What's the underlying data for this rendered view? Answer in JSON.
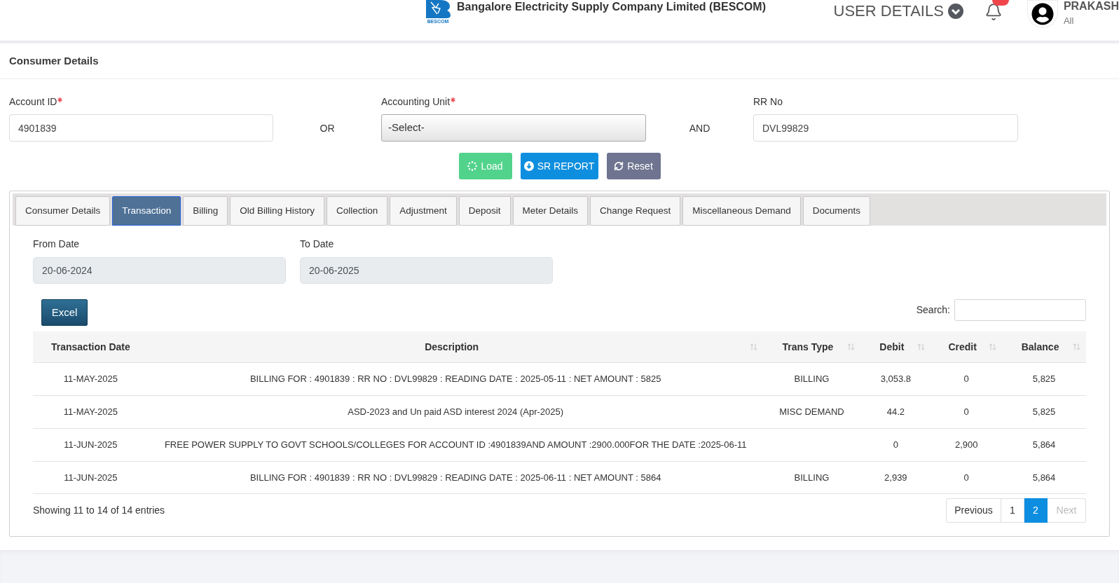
{
  "header": {
    "logo_text": "BESCOM",
    "title": "Bangalore Electricity Supply Company Limited (BESCOM)",
    "user_menu": "USER DETAILS",
    "notification_badge": true,
    "user": {
      "name": "PRAKASH",
      "role": "All"
    }
  },
  "section_title": "Consumer Details",
  "form": {
    "fields": [
      {
        "kind": "input",
        "label": "Account ID",
        "required": true,
        "value": "4901839"
      },
      {
        "kind": "connector",
        "text": "OR"
      },
      {
        "kind": "select",
        "label": "Accounting Unit",
        "required": true,
        "value": "-Select-"
      },
      {
        "kind": "connector",
        "text": "AND"
      },
      {
        "kind": "input",
        "label": "RR No",
        "required": false,
        "value": "DVL99829"
      }
    ]
  },
  "buttons": [
    {
      "kind": "load",
      "label": "Load"
    },
    {
      "kind": "report",
      "label": "SR REPORT"
    },
    {
      "kind": "reset",
      "label": "Reset"
    }
  ],
  "tabs": [
    {
      "label": "Consumer Details",
      "selected": false
    },
    {
      "label": "Transaction",
      "selected": true
    },
    {
      "label": "Billing",
      "selected": false
    },
    {
      "label": "Old Billing History",
      "selected": false
    },
    {
      "label": "Collection",
      "selected": false
    },
    {
      "label": "Adjustment",
      "selected": false
    },
    {
      "label": "Deposit",
      "selected": false
    },
    {
      "label": "Meter Details",
      "selected": false
    },
    {
      "label": "Change Request",
      "selected": false
    },
    {
      "label": "Miscellaneous Demand",
      "selected": false
    },
    {
      "label": "Documents",
      "selected": false
    }
  ],
  "date_filters": [
    {
      "label": "From Date",
      "value": "20-06-2024"
    },
    {
      "label": "To Date",
      "value": "20-06-2025"
    }
  ],
  "export_button": "Excel",
  "search": {
    "label": "Search:"
  },
  "table": {
    "columns": [
      {
        "label": "Transaction Date",
        "sortable": false
      },
      {
        "label": "Description",
        "sortable": true
      },
      {
        "label": "Trans Type",
        "sortable": true
      },
      {
        "label": "Debit",
        "sortable": true
      },
      {
        "label": "Credit",
        "sortable": true
      },
      {
        "label": "Balance",
        "sortable": true
      }
    ],
    "rows": [
      {
        "date": "11-MAY-2025",
        "description": "BILLING FOR : 4901839 : RR NO : DVL99829 : READING DATE : 2025-05-11 : NET AMOUNT : 5825",
        "trans_type": "BILLING",
        "debit": "3,053.8",
        "credit": "0",
        "balance": "5,825"
      },
      {
        "date": "11-MAY-2025",
        "description": "ASD-2023 and Un paid ASD interest 2024 (Apr-2025)",
        "trans_type": "MISC DEMAND",
        "debit": "44.2",
        "credit": "0",
        "balance": "5,825"
      },
      {
        "date": "11-JUN-2025",
        "description": "FREE POWER SUPPLY TO GOVT SCHOOLS/COLLEGES FOR ACCOUNT ID :4901839AND AMOUNT :2900.000FOR THE DATE :2025-06-11",
        "debit": "0",
        "credit": "2,900",
        "balance": "5,864"
      },
      {
        "date": "11-JUN-2025",
        "description": "BILLING FOR : 4901839 : RR NO : DVL99829 : READING DATE : 2025-06-11 : NET AMOUNT : 5864",
        "trans_type": "BILLING",
        "debit": "2,939",
        "credit": "0",
        "balance": "5,864"
      }
    ]
  },
  "table_info": "Showing 11 to 14 of 14 entries",
  "pagination": {
    "previous": {
      "label": "Previous",
      "disabled": false
    },
    "pages": [
      {
        "label": "1",
        "selected": false
      },
      {
        "label": "2",
        "selected": true
      }
    ],
    "next": {
      "label": "Next",
      "disabled": true
    }
  }
}
